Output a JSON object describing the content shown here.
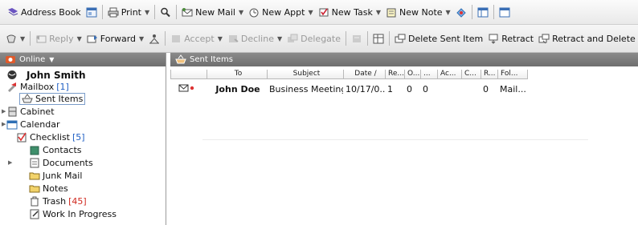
{
  "toolbar1": {
    "address_book": "Address Book",
    "print": "Print",
    "new_mail": "New Mail",
    "new_appt": "New Appt",
    "new_task": "New Task",
    "new_note": "New Note"
  },
  "toolbar2": {
    "reply": "Reply",
    "forward": "Forward",
    "accept": "Accept",
    "decline": "Decline",
    "delegate": "Delegate",
    "delete_sent_item": "Delete Sent Item",
    "retract": "Retract",
    "retract_and_delete": "Retract and Delete"
  },
  "left_panel": {
    "header": "Online",
    "user": "John Smith",
    "mailbox": "Mailbox",
    "mailbox_count": "[1]",
    "sent_items": "Sent Items",
    "cabinet": "Cabinet",
    "calendar": "Calendar",
    "checklist": "Checklist",
    "checklist_count": "[5]",
    "contacts": "Contacts",
    "documents": "Documents",
    "junk_mail": "Junk Mail",
    "notes": "Notes",
    "trash": "Trash",
    "trash_count": "[45]",
    "work_in_progress": "Work In Progress"
  },
  "right_panel": {
    "header": "Sent Items",
    "columns": [
      "",
      "To",
      "Subject",
      "Date ∕",
      "Re...",
      "O...",
      "...",
      "Ac...",
      "C...",
      "R...",
      "Fol..."
    ],
    "rows": [
      [
        "",
        "John Doe",
        "Business Meeting",
        "10/17/0...",
        "1",
        "0",
        "0",
        "",
        "",
        "0",
        "Mail..."
      ]
    ]
  },
  "colors": {
    "panel_header_bg": "#7d7d7d",
    "count_blue": "#1f5fc4",
    "count_red": "#d0281e"
  }
}
